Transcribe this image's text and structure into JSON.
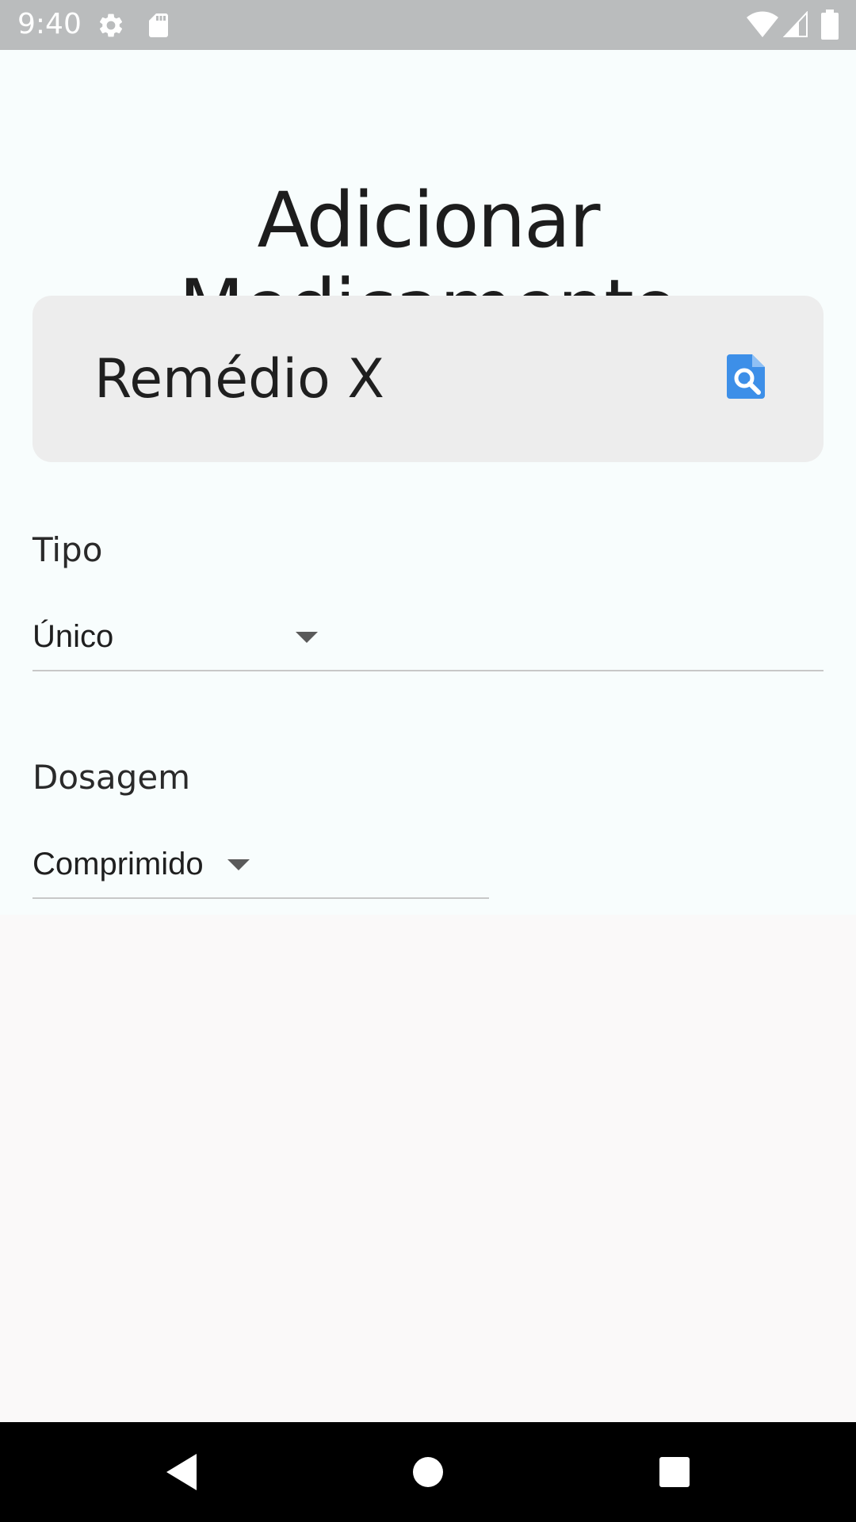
{
  "status_bar": {
    "time": "9:40",
    "icons": [
      "gear-icon",
      "sd-card-icon",
      "wifi-icon",
      "signal-icon",
      "battery-icon"
    ],
    "color": "#babcbd"
  },
  "page": {
    "title": "Adicionar Medicamento",
    "background": "#f8fdfd"
  },
  "medication_name": {
    "value": "Remédio X",
    "icon": "document-search-icon",
    "icon_color": "#3d8fe8"
  },
  "tipo": {
    "label": "Tipo",
    "selected": "Único"
  },
  "dosagem": {
    "label": "Dosagem",
    "selected": "Comprimido"
  },
  "nav_bar": {
    "buttons": [
      "back-icon",
      "home-icon",
      "recents-icon"
    ]
  }
}
